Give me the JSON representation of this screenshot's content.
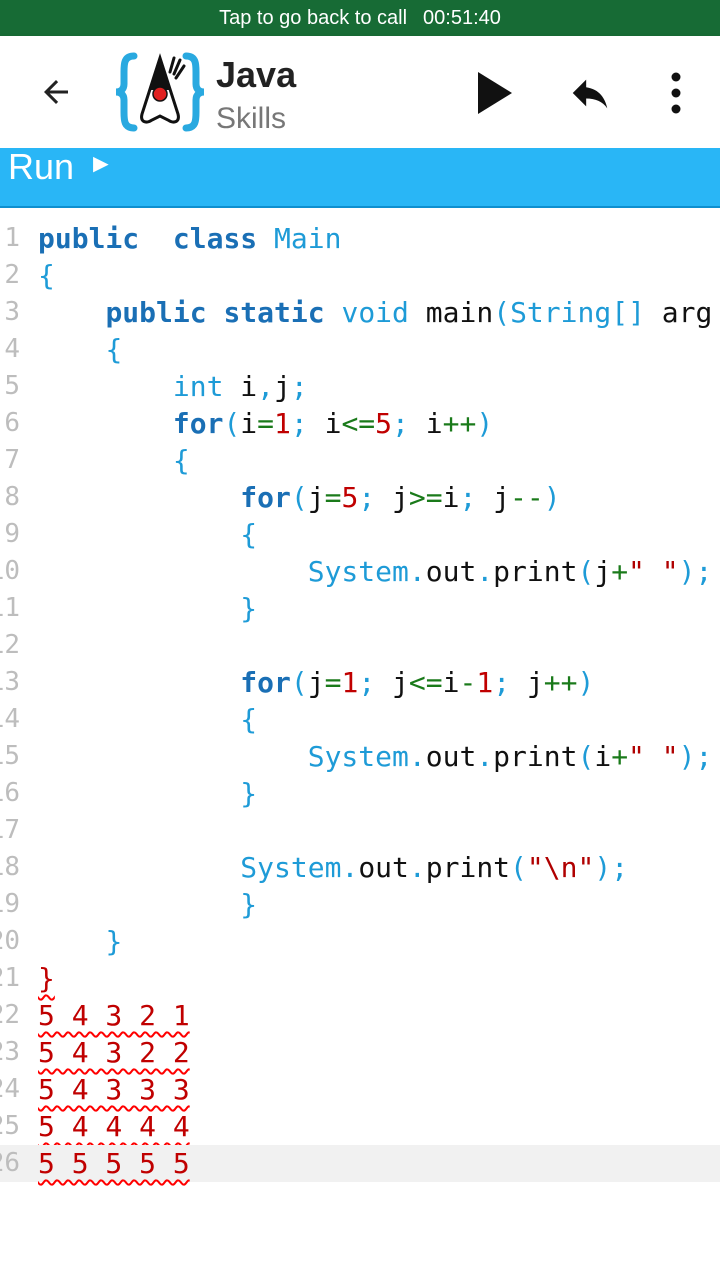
{
  "status_bar": {
    "call_text": "Tap to go back to call",
    "call_time": "00:51:40"
  },
  "app_bar": {
    "title": "Java",
    "subtitle": "Skills",
    "back_icon": "arrow-back-icon",
    "run_icon": "play-icon",
    "undo_icon": "undo-icon",
    "more_icon": "more-vert-icon"
  },
  "run_bar": {
    "label": "Run",
    "arrow": "►"
  },
  "editor": {
    "lines": [
      {
        "n": "1",
        "tokens": [
          [
            "kw",
            "public"
          ],
          [
            "",
            "  "
          ],
          [
            "kw",
            "class"
          ],
          [
            "",
            " "
          ],
          [
            "ty",
            "Main"
          ]
        ]
      },
      {
        "n": "2",
        "tokens": [
          [
            "p",
            "{"
          ]
        ]
      },
      {
        "n": "3",
        "tokens": [
          [
            "",
            "    "
          ],
          [
            "kw",
            "public"
          ],
          [
            "",
            " "
          ],
          [
            "kw",
            "static"
          ],
          [
            "",
            " "
          ],
          [
            "ty",
            "void"
          ],
          [
            "",
            " main"
          ],
          [
            "p",
            "("
          ],
          [
            "ty",
            "String[]"
          ],
          [
            "",
            " arg"
          ]
        ]
      },
      {
        "n": "4",
        "tokens": [
          [
            "",
            "    "
          ],
          [
            "p",
            "{"
          ]
        ]
      },
      {
        "n": "5",
        "tokens": [
          [
            "",
            "        "
          ],
          [
            "ty",
            "int"
          ],
          [
            "",
            " i"
          ],
          [
            "p",
            ","
          ],
          [
            "",
            "j"
          ],
          [
            "p",
            ";"
          ]
        ]
      },
      {
        "n": "6",
        "tokens": [
          [
            "",
            "        "
          ],
          [
            "kw",
            "for"
          ],
          [
            "p",
            "("
          ],
          [
            "",
            "i"
          ],
          [
            "op",
            "="
          ],
          [
            "num",
            "1"
          ],
          [
            "p",
            ";"
          ],
          [
            "",
            " i"
          ],
          [
            "op",
            "<="
          ],
          [
            "num",
            "5"
          ],
          [
            "p",
            ";"
          ],
          [
            "",
            " i"
          ],
          [
            "op",
            "++"
          ],
          [
            "p",
            ")"
          ]
        ]
      },
      {
        "n": "7",
        "tokens": [
          [
            "",
            "        "
          ],
          [
            "p",
            "{"
          ]
        ]
      },
      {
        "n": "8",
        "tokens": [
          [
            "",
            "            "
          ],
          [
            "kw",
            "for"
          ],
          [
            "p",
            "("
          ],
          [
            "",
            "j"
          ],
          [
            "op",
            "="
          ],
          [
            "num",
            "5"
          ],
          [
            "p",
            ";"
          ],
          [
            "",
            " j"
          ],
          [
            "op",
            ">="
          ],
          [
            "",
            "i"
          ],
          [
            "p",
            ";"
          ],
          [
            "",
            " j"
          ],
          [
            "op",
            "--"
          ],
          [
            "p",
            ")"
          ]
        ]
      },
      {
        "n": "9",
        "tokens": [
          [
            "",
            "            "
          ],
          [
            "p",
            "{"
          ]
        ]
      },
      {
        "n": "10",
        "tokens": [
          [
            "",
            "                "
          ],
          [
            "ty",
            "System"
          ],
          [
            "p",
            "."
          ],
          [
            "",
            "out"
          ],
          [
            "p",
            "."
          ],
          [
            "",
            "print"
          ],
          [
            "p",
            "("
          ],
          [
            "",
            "j"
          ],
          [
            "op",
            "+"
          ],
          [
            "str",
            "\" \""
          ],
          [
            "p",
            ");"
          ]
        ]
      },
      {
        "n": "11",
        "tokens": [
          [
            "",
            "            "
          ],
          [
            "p",
            "}"
          ]
        ]
      },
      {
        "n": "12",
        "tokens": []
      },
      {
        "n": "13",
        "tokens": [
          [
            "",
            "            "
          ],
          [
            "kw",
            "for"
          ],
          [
            "p",
            "("
          ],
          [
            "",
            "j"
          ],
          [
            "op",
            "="
          ],
          [
            "num",
            "1"
          ],
          [
            "p",
            ";"
          ],
          [
            "",
            " j"
          ],
          [
            "op",
            "<="
          ],
          [
            "",
            "i"
          ],
          [
            "op",
            "-"
          ],
          [
            "num",
            "1"
          ],
          [
            "p",
            ";"
          ],
          [
            "",
            " j"
          ],
          [
            "op",
            "++"
          ],
          [
            "p",
            ")"
          ]
        ]
      },
      {
        "n": "14",
        "tokens": [
          [
            "",
            "            "
          ],
          [
            "p",
            "{"
          ]
        ]
      },
      {
        "n": "15",
        "tokens": [
          [
            "",
            "                "
          ],
          [
            "ty",
            "System"
          ],
          [
            "p",
            "."
          ],
          [
            "",
            "out"
          ],
          [
            "p",
            "."
          ],
          [
            "",
            "print"
          ],
          [
            "p",
            "("
          ],
          [
            "",
            "i"
          ],
          [
            "op",
            "+"
          ],
          [
            "str",
            "\" \""
          ],
          [
            "p",
            ");"
          ]
        ]
      },
      {
        "n": "16",
        "tokens": [
          [
            "",
            "            "
          ],
          [
            "p",
            "}"
          ]
        ]
      },
      {
        "n": "17",
        "tokens": []
      },
      {
        "n": "18",
        "tokens": [
          [
            "",
            "            "
          ],
          [
            "ty",
            "System"
          ],
          [
            "p",
            "."
          ],
          [
            "",
            "out"
          ],
          [
            "p",
            "."
          ],
          [
            "",
            "print"
          ],
          [
            "p",
            "("
          ],
          [
            "str",
            "\"\\n\""
          ],
          [
            "p",
            ");"
          ]
        ]
      },
      {
        "n": "19",
        "tokens": [
          [
            "",
            "            "
          ],
          [
            "p",
            "}"
          ]
        ]
      },
      {
        "n": "20",
        "tokens": [
          [
            "",
            "    "
          ],
          [
            "p",
            "}"
          ]
        ]
      },
      {
        "n": "21",
        "tokens": [
          [
            "err",
            "}"
          ]
        ]
      },
      {
        "n": "22",
        "tokens": [
          [
            "err",
            "5 4 3 2 1"
          ]
        ]
      },
      {
        "n": "23",
        "tokens": [
          [
            "err",
            "5 4 3 2 2"
          ]
        ]
      },
      {
        "n": "24",
        "tokens": [
          [
            "err",
            "5 4 3 3 3"
          ]
        ]
      },
      {
        "n": "25",
        "tokens": [
          [
            "err",
            "5 4 4 4 4"
          ]
        ]
      },
      {
        "n": "26",
        "tokens": [
          [
            "err",
            "5 5 5 5 5"
          ]
        ]
      }
    ],
    "current_line": "26"
  }
}
